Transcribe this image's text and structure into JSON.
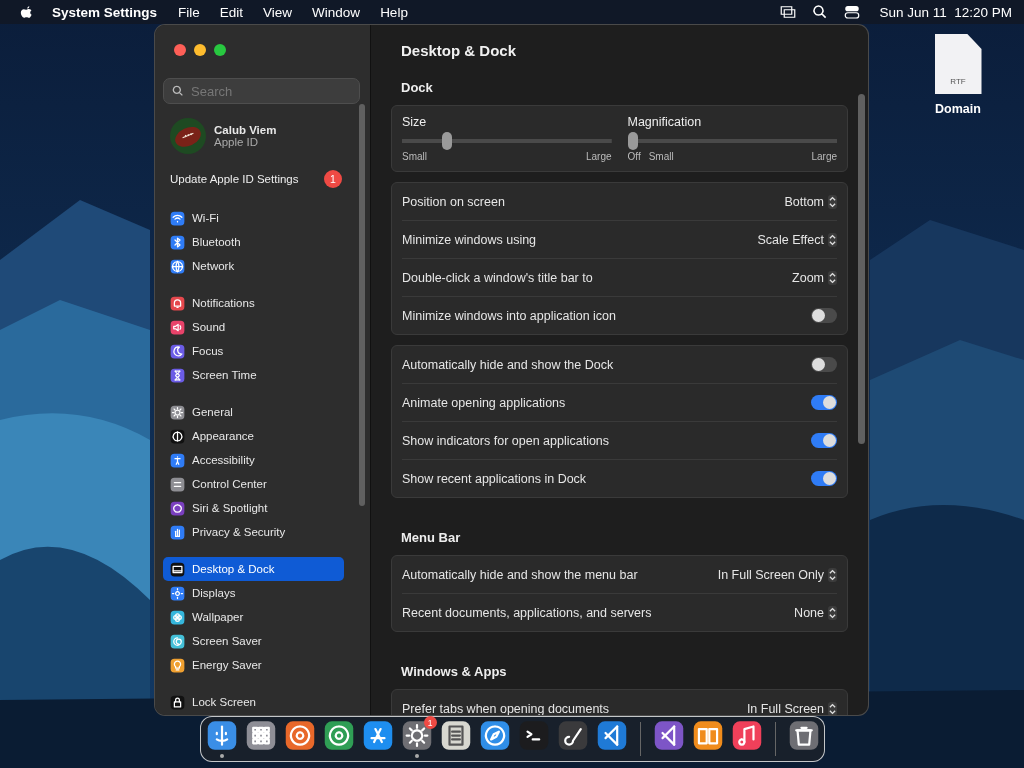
{
  "menu_bar": {
    "app_name": "System Settings",
    "menus": [
      "File",
      "Edit",
      "View",
      "Window",
      "Help"
    ],
    "clock": "Sun Jun 11  12:20 PM"
  },
  "desktop_icons": [
    {
      "label": "Domain",
      "file_type": "RTF"
    }
  ],
  "window": {
    "sidebar": {
      "search": {
        "placeholder": "Search"
      },
      "account": {
        "name": "Calub Viem",
        "subtitle": "Apple ID"
      },
      "notice": {
        "label": "Update Apple ID Settings",
        "badge": "1"
      },
      "groups": [
        [
          {
            "label": "Wi-Fi",
            "color": "#2f7cf6",
            "selected": false
          },
          {
            "label": "Bluetooth",
            "color": "#2f7cf6",
            "selected": false
          },
          {
            "label": "Network",
            "color": "#2f7cf6",
            "selected": false
          }
        ],
        [
          {
            "label": "Notifications",
            "color": "#e5484d",
            "selected": false
          },
          {
            "label": "Sound",
            "color": "#e8436a",
            "selected": false
          },
          {
            "label": "Focus",
            "color": "#6b5ce6",
            "selected": false
          },
          {
            "label": "Screen Time",
            "color": "#6b5ce6",
            "selected": false
          }
        ],
        [
          {
            "label": "General",
            "color": "#8e8e93",
            "selected": false
          },
          {
            "label": "Appearance",
            "color": "#111111",
            "selected": false
          },
          {
            "label": "Accessibility",
            "color": "#2f7cf6",
            "selected": false
          },
          {
            "label": "Control Center",
            "color": "#8e8e93",
            "selected": false
          },
          {
            "label": "Siri & Spotlight",
            "color": "#7a3fbf",
            "selected": false
          },
          {
            "label": "Privacy & Security",
            "color": "#2f7cf6",
            "selected": false
          }
        ],
        [
          {
            "label": "Desktop & Dock",
            "color": "#111111",
            "selected": true
          },
          {
            "label": "Displays",
            "color": "#2f7cf6",
            "selected": false
          },
          {
            "label": "Wallpaper",
            "color": "#35b6dc",
            "selected": false
          },
          {
            "label": "Screen Saver",
            "color": "#44c0d8",
            "selected": false
          },
          {
            "label": "Energy Saver",
            "color": "#f0a030",
            "selected": false
          }
        ],
        [
          {
            "label": "Lock Screen",
            "color": "#111111",
            "selected": false
          }
        ]
      ]
    },
    "content": {
      "title": "Desktop & Dock",
      "sections": [
        {
          "title": "Dock",
          "groups": [
            [
              {
                "kind": "sliders",
                "sliders": [
                  {
                    "label": "Size",
                    "level": 0.2,
                    "scale": [
                      "Small",
                      "Large"
                    ]
                  },
                  {
                    "label": "Magnification",
                    "level": 0,
                    "scale": [
                      "Off",
                      "Small",
                      "Large"
                    ]
                  }
                ]
              }
            ],
            [
              {
                "kind": "popup",
                "label": "Position on screen",
                "value": "Bottom"
              },
              {
                "kind": "popup",
                "label": "Minimize windows using",
                "value": "Scale Effect"
              },
              {
                "kind": "popup",
                "label": "Double-click a window's title bar to",
                "value": "Zoom"
              },
              {
                "kind": "toggle",
                "label": "Minimize windows into application icon",
                "on": false
              }
            ],
            [
              {
                "kind": "toggle",
                "label": "Automatically hide and show the Dock",
                "on": false
              },
              {
                "kind": "toggle",
                "label": "Animate opening applications",
                "on": true
              },
              {
                "kind": "toggle",
                "label": "Show indicators for open applications",
                "on": true
              },
              {
                "kind": "toggle",
                "label": "Show recent applications in Dock",
                "on": true
              }
            ]
          ]
        },
        {
          "title": "Menu Bar",
          "groups": [
            [
              {
                "kind": "popup",
                "label": "Automatically hide and show the menu bar",
                "value": "In Full Screen Only"
              },
              {
                "kind": "popup",
                "label": "Recent documents, applications, and servers",
                "value": "None"
              }
            ]
          ]
        },
        {
          "title": "Windows & Apps",
          "groups": [
            [
              {
                "kind": "popup",
                "label": "Prefer tabs when opening documents",
                "value": "In Full Screen"
              }
            ]
          ]
        }
      ]
    }
  },
  "dock": {
    "items": [
      {
        "kind": "app",
        "color": "#3a8ee6",
        "running": true
      },
      {
        "kind": "app",
        "color": "#8e8e96",
        "running": false
      },
      {
        "kind": "app",
        "color": "#e8682a",
        "running": false
      },
      {
        "kind": "app",
        "color": "#2f9e55",
        "running": false
      },
      {
        "kind": "app",
        "color": "#1e8ef0",
        "running": false
      },
      {
        "kind": "app",
        "color": "#6e6e73",
        "running": true,
        "badge": "1"
      },
      {
        "kind": "app",
        "color": "#d8d8d0",
        "running": false
      },
      {
        "kind": "app",
        "color": "#2f8ee8",
        "running": false
      },
      {
        "kind": "app",
        "color": "#1c1c1e",
        "running": false
      },
      {
        "kind": "app",
        "color": "#3a3a3c",
        "running": false
      },
      {
        "kind": "app",
        "color": "#1f7ad6",
        "running": false
      },
      {
        "kind": "separator"
      },
      {
        "kind": "app",
        "color": "#7d55c7",
        "running": false
      },
      {
        "kind": "app",
        "color": "#f08c1c",
        "running": false
      },
      {
        "kind": "app",
        "color": "#f0405a",
        "running": false
      },
      {
        "kind": "separator"
      },
      {
        "kind": "app",
        "color": "#6e6e73",
        "running": false
      }
    ]
  }
}
